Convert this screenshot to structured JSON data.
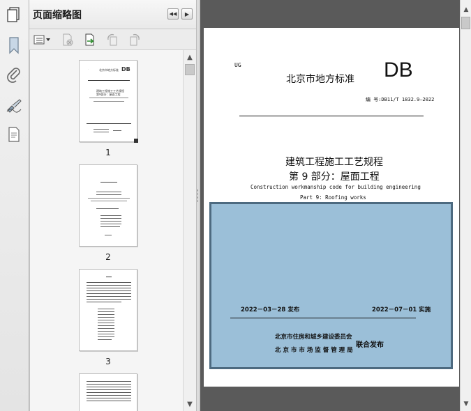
{
  "sidebar_panel": {
    "title": "页面缩略图",
    "nav_prev_label": "◀◀",
    "nav_next_label": "▶"
  },
  "rail": {
    "icons": [
      "pages-icon",
      "bookmark-icon",
      "attachment-icon",
      "signature-icon",
      "layers-icon"
    ]
  },
  "thumbnails": [
    {
      "page": "1"
    },
    {
      "page": "2"
    },
    {
      "page": "3"
    }
  ],
  "document": {
    "corner_mark": "UG",
    "standard_org": "北京市地方标准",
    "logo": "DB",
    "standard_number": "编  号:DB11/T 1832.9—2022",
    "title_cn_1": "建筑工程施工工艺规程",
    "title_cn_2": "第 9 部分：屋面工程",
    "title_en_1": "Construction workmanship code for building engineering",
    "title_en_2": "Part 9: Roofing works",
    "issue_date": "2022－03－28 发布",
    "effective_date": "2022－07－01 实施",
    "publisher_1": "北京市住房和城乡建设委员会",
    "publisher_2": "北 京 市 市 场 监 督 管 理 局",
    "joint_publish": "联合发布"
  },
  "mini_page1": {
    "org": "北京市地方标准",
    "logo": "DB",
    "title": "建筑工程施工工艺规程",
    "part": "第9部分：屋面工程"
  }
}
